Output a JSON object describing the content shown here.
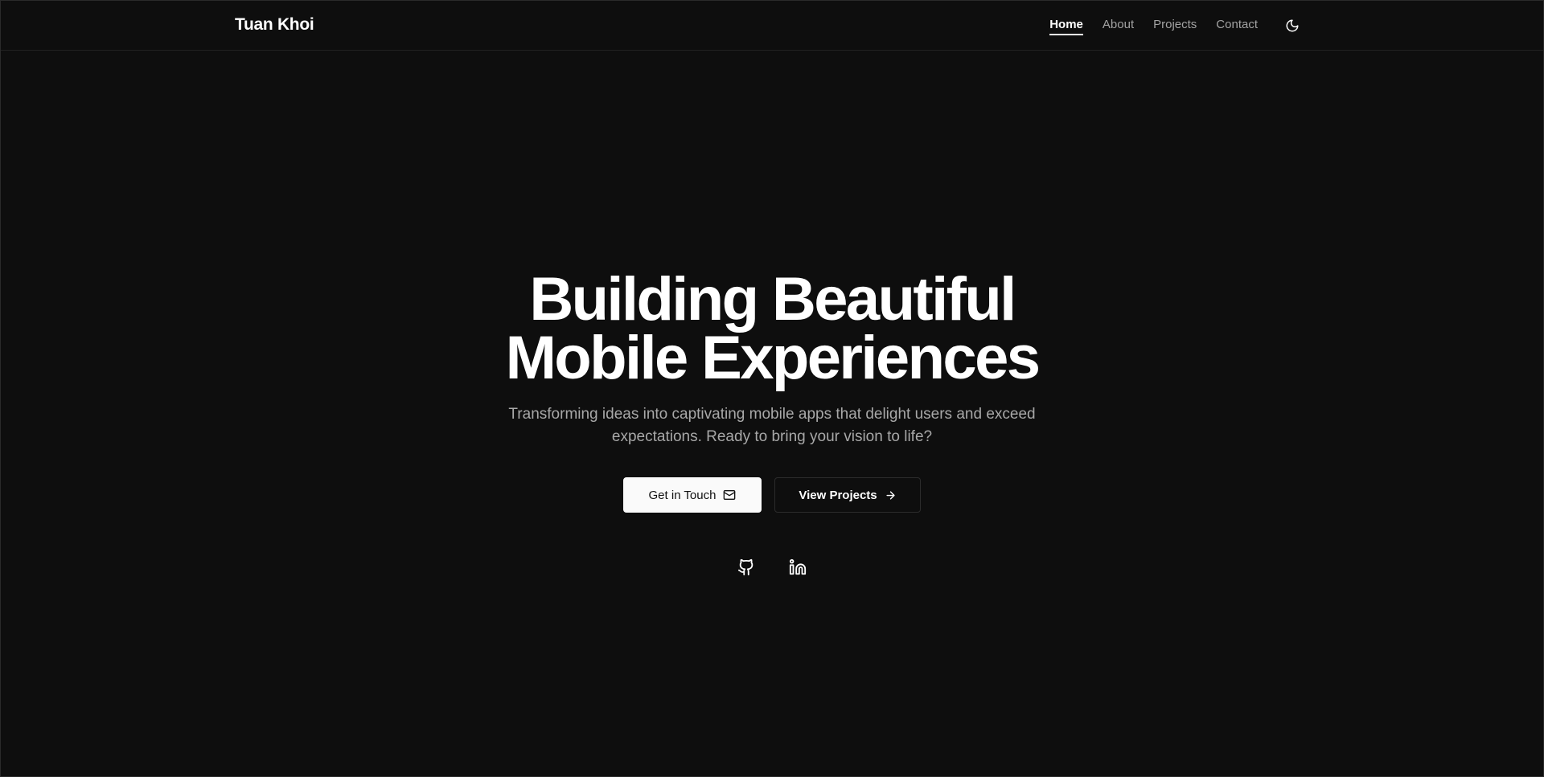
{
  "header": {
    "brand": "Tuan Khoi",
    "nav": [
      {
        "label": "Home",
        "active": true
      },
      {
        "label": "About",
        "active": false
      },
      {
        "label": "Projects",
        "active": false
      },
      {
        "label": "Contact",
        "active": false
      }
    ],
    "theme_toggle_icon": "moon-icon"
  },
  "hero": {
    "title_line1": "Building Beautiful",
    "title_line2": "Mobile Experiences",
    "subtitle": "Transforming ideas into captivating mobile apps that delight users and exceed expectations. Ready to bring your vision to life?",
    "primary_button": {
      "label": "Get in Touch",
      "icon": "mail-icon"
    },
    "secondary_button": {
      "label": "View Projects",
      "icon": "arrow-right-icon"
    },
    "socials": [
      {
        "icon": "github-icon"
      },
      {
        "icon": "linkedin-icon"
      }
    ]
  },
  "colors": {
    "background": "#0e0e0e",
    "text": "#ffffff",
    "muted": "#a3a3a3",
    "primary_button_bg": "#fafafa"
  }
}
